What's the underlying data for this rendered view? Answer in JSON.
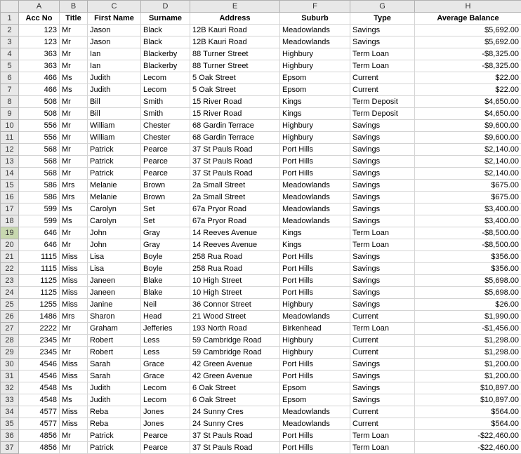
{
  "columns": [
    "A",
    "B",
    "C",
    "D",
    "E",
    "F",
    "G",
    "H"
  ],
  "headers": {
    "A": "Acc No",
    "B": "Title",
    "C": "First Name",
    "D": "Surname",
    "E": "Address",
    "F": "Suburb",
    "G": "Type",
    "H": "Average Balance"
  },
  "selected_row": 19,
  "chart_data": {
    "type": "table",
    "title": "",
    "columns": [
      "Acc No",
      "Title",
      "First Name",
      "Surname",
      "Address",
      "Suburb",
      "Type",
      "Average Balance"
    ],
    "rows": [
      [
        123,
        "Mr",
        "Jason",
        "Black",
        "12B Kauri Road",
        "Meadowlands",
        "Savings",
        "$5,692.00"
      ],
      [
        123,
        "Mr",
        "Jason",
        "Black",
        "12B Kauri Road",
        "Meadowlands",
        "Savings",
        "$5,692.00"
      ],
      [
        363,
        "Mr",
        "Ian",
        "Blackerby",
        "88 Turner Street",
        "Highbury",
        "Term Loan",
        "-$8,325.00"
      ],
      [
        363,
        "Mr",
        "Ian",
        "Blackerby",
        "88 Turner Street",
        "Highbury",
        "Term Loan",
        "-$8,325.00"
      ],
      [
        466,
        "Ms",
        "Judith",
        "Lecom",
        "5 Oak Street",
        "Epsom",
        "Current",
        "$22.00"
      ],
      [
        466,
        "Ms",
        "Judith",
        "Lecom",
        "5 Oak Street",
        "Epsom",
        "Current",
        "$22.00"
      ],
      [
        508,
        "Mr",
        "Bill",
        "Smith",
        "15 River Road",
        "Kings",
        "Term Deposit",
        "$4,650.00"
      ],
      [
        508,
        "Mr",
        "Bill",
        "Smith",
        "15 River Road",
        "Kings",
        "Term Deposit",
        "$4,650.00"
      ],
      [
        556,
        "Mr",
        "William",
        "Chester",
        "68 Gardin Terrace",
        "Highbury",
        "Savings",
        "$9,600.00"
      ],
      [
        556,
        "Mr",
        "William",
        "Chester",
        "68 Gardin Terrace",
        "Highbury",
        "Savings",
        "$9,600.00"
      ],
      [
        568,
        "Mr",
        "Patrick",
        "Pearce",
        "37 St Pauls Road",
        "Port Hills",
        "Savings",
        "$2,140.00"
      ],
      [
        568,
        "Mr",
        "Patrick",
        "Pearce",
        "37 St Pauls Road",
        "Port Hills",
        "Savings",
        "$2,140.00"
      ],
      [
        568,
        "Mr",
        "Patrick",
        "Pearce",
        "37 St Pauls Road",
        "Port Hills",
        "Savings",
        "$2,140.00"
      ],
      [
        586,
        "Mrs",
        "Melanie",
        "Brown",
        "2a Small Street",
        "Meadowlands",
        "Savings",
        "$675.00"
      ],
      [
        586,
        "Mrs",
        "Melanie",
        "Brown",
        "2a Small Street",
        "Meadowlands",
        "Savings",
        "$675.00"
      ],
      [
        599,
        "Ms",
        "Carolyn",
        "Set",
        "67a Pryor Road",
        "Meadowlands",
        "Savings",
        "$3,400.00"
      ],
      [
        599,
        "Ms",
        "Carolyn",
        "Set",
        "67a Pryor Road",
        "Meadowlands",
        "Savings",
        "$3,400.00"
      ],
      [
        646,
        "Mr",
        "John",
        "Gray",
        "14 Reeves Avenue",
        "Kings",
        "Term Loan",
        "-$8,500.00"
      ],
      [
        646,
        "Mr",
        "John",
        "Gray",
        "14 Reeves Avenue",
        "Kings",
        "Term Loan",
        "-$8,500.00"
      ],
      [
        1115,
        "Miss",
        "Lisa",
        "Boyle",
        "258 Rua Road",
        "Port Hills",
        "Savings",
        "$356.00"
      ],
      [
        1115,
        "Miss",
        "Lisa",
        "Boyle",
        "258 Rua Road",
        "Port Hills",
        "Savings",
        "$356.00"
      ],
      [
        1125,
        "Miss",
        "Janeen",
        "Blake",
        "10 High Street",
        "Port Hills",
        "Savings",
        "$5,698.00"
      ],
      [
        1125,
        "Miss",
        "Janeen",
        "Blake",
        "10 High Street",
        "Port Hills",
        "Savings",
        "$5,698.00"
      ],
      [
        1255,
        "Miss",
        "Janine",
        "Neil",
        "36 Connor Street",
        "Highbury",
        "Savings",
        "$26.00"
      ],
      [
        1486,
        "Mrs",
        "Sharon",
        "Head",
        "21 Wood Street",
        "Meadowlands",
        "Current",
        "$1,990.00"
      ],
      [
        2222,
        "Mr",
        "Graham",
        "Jefferies",
        "193 North Road",
        "Birkenhead",
        "Term Loan",
        "-$1,456.00"
      ],
      [
        2345,
        "Mr",
        "Robert",
        "Less",
        "59 Cambridge Road",
        "Highbury",
        "Current",
        "$1,298.00"
      ],
      [
        2345,
        "Mr",
        "Robert",
        "Less",
        "59 Cambridge Road",
        "Highbury",
        "Current",
        "$1,298.00"
      ],
      [
        4546,
        "Miss",
        "Sarah",
        "Grace",
        "42 Green Avenue",
        "Port Hills",
        "Savings",
        "$1,200.00"
      ],
      [
        4546,
        "Miss",
        "Sarah",
        "Grace",
        "42 Green Avenue",
        "Port Hills",
        "Savings",
        "$1,200.00"
      ],
      [
        4548,
        "Ms",
        "Judith",
        "Lecom",
        "6 Oak Street",
        "Epsom",
        "Savings",
        "$10,897.00"
      ],
      [
        4548,
        "Ms",
        "Judith",
        "Lecom",
        "6 Oak Street",
        "Epsom",
        "Savings",
        "$10,897.00"
      ],
      [
        4577,
        "Miss",
        "Reba",
        "Jones",
        "24 Sunny Cres",
        "Meadowlands",
        "Current",
        "$564.00"
      ],
      [
        4577,
        "Miss",
        "Reba",
        "Jones",
        "24 Sunny Cres",
        "Meadowlands",
        "Current",
        "$564.00"
      ],
      [
        4856,
        "Mr",
        "Patrick",
        "Pearce",
        "37 St Pauls Road",
        "Port Hills",
        "Term Loan",
        "-$22,460.00"
      ],
      [
        4856,
        "Mr",
        "Patrick",
        "Pearce",
        "37 St Pauls Road",
        "Port Hills",
        "Term Loan",
        "-$22,460.00"
      ]
    ]
  }
}
